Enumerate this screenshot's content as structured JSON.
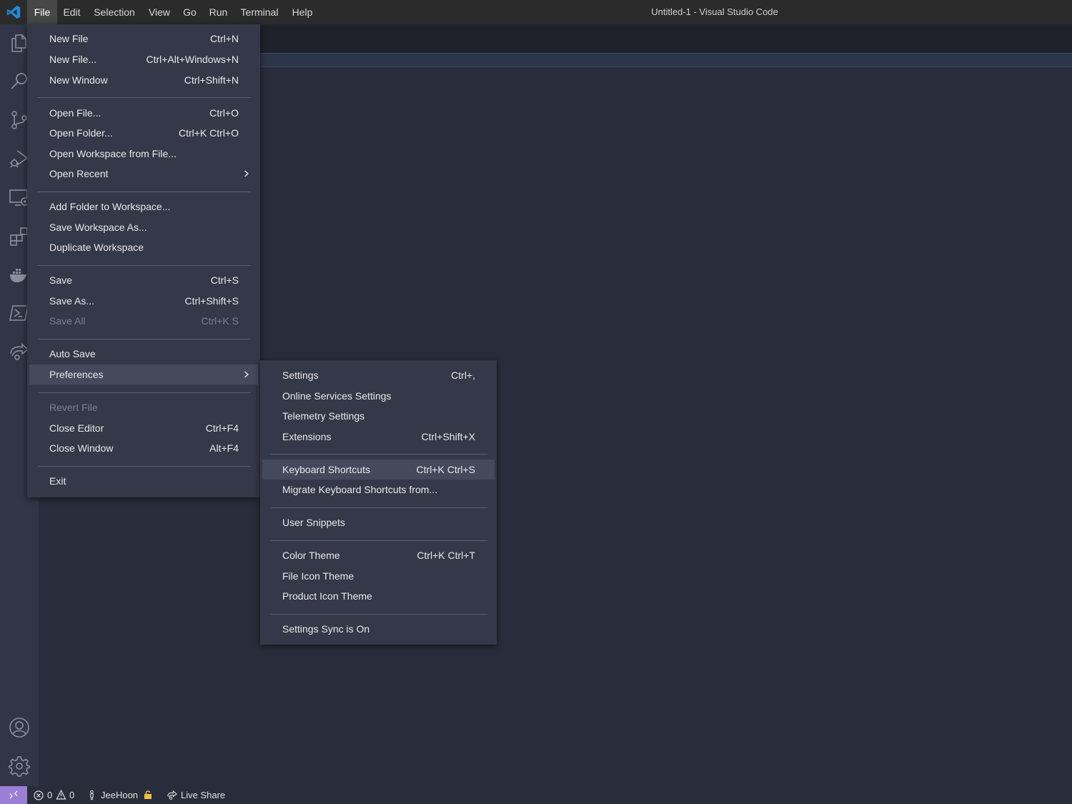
{
  "titlebar": {
    "menus": [
      "File",
      "Edit",
      "Selection",
      "View",
      "Go",
      "Run",
      "Terminal",
      "Help"
    ],
    "window_title": "Untitled-1 - Visual Studio Code"
  },
  "activitybar": {
    "icons": [
      "explorer-icon",
      "search-icon",
      "source-control-icon",
      "run-debug-icon",
      "remote-explorer-icon",
      "extensions-icon",
      "docker-icon",
      "powershell-icon",
      "live-share-icon",
      "accounts-icon",
      "manage-gear-icon"
    ]
  },
  "file_menu": {
    "new_file": {
      "label": "New File",
      "shortcut": "Ctrl+N"
    },
    "new_file_dots": {
      "label": "New File...",
      "shortcut": "Ctrl+Alt+Windows+N"
    },
    "new_window": {
      "label": "New Window",
      "shortcut": "Ctrl+Shift+N"
    },
    "open_file": {
      "label": "Open File...",
      "shortcut": "Ctrl+O"
    },
    "open_folder": {
      "label": "Open Folder...",
      "shortcut": "Ctrl+K Ctrl+O"
    },
    "open_workspace": {
      "label": "Open Workspace from File..."
    },
    "open_recent": {
      "label": "Open Recent"
    },
    "add_folder": {
      "label": "Add Folder to Workspace..."
    },
    "save_workspace_as": {
      "label": "Save Workspace As..."
    },
    "duplicate_workspace": {
      "label": "Duplicate Workspace"
    },
    "save": {
      "label": "Save",
      "shortcut": "Ctrl+S"
    },
    "save_as": {
      "label": "Save As...",
      "shortcut": "Ctrl+Shift+S"
    },
    "save_all": {
      "label": "Save All",
      "shortcut": "Ctrl+K S"
    },
    "auto_save": {
      "label": "Auto Save"
    },
    "preferences": {
      "label": "Preferences"
    },
    "revert_file": {
      "label": "Revert File"
    },
    "close_editor": {
      "label": "Close Editor",
      "shortcut": "Ctrl+F4"
    },
    "close_window": {
      "label": "Close Window",
      "shortcut": "Alt+F4"
    },
    "exit": {
      "label": "Exit"
    }
  },
  "preferences_menu": {
    "settings": {
      "label": "Settings",
      "shortcut": "Ctrl+,"
    },
    "online_services": {
      "label": "Online Services Settings"
    },
    "telemetry": {
      "label": "Telemetry Settings"
    },
    "extensions": {
      "label": "Extensions",
      "shortcut": "Ctrl+Shift+X"
    },
    "keyboard_shortcuts": {
      "label": "Keyboard Shortcuts",
      "shortcut": "Ctrl+K Ctrl+S"
    },
    "migrate_shortcuts": {
      "label": "Migrate Keyboard Shortcuts from..."
    },
    "user_snippets": {
      "label": "User Snippets"
    },
    "color_theme": {
      "label": "Color Theme",
      "shortcut": "Ctrl+K Ctrl+T"
    },
    "file_icon_theme": {
      "label": "File Icon Theme"
    },
    "product_icon_theme": {
      "label": "Product Icon Theme"
    },
    "settings_sync": {
      "label": "Settings Sync is On"
    }
  },
  "statusbar": {
    "errors": "0",
    "warnings": "0",
    "user": "JeeHoon",
    "live_share": "Live Share"
  },
  "colors": {
    "accent": "#9b7ed6",
    "vscode_blue": "#2489db",
    "menu_bg": "#353848",
    "editor_bg": "#292c3a"
  }
}
